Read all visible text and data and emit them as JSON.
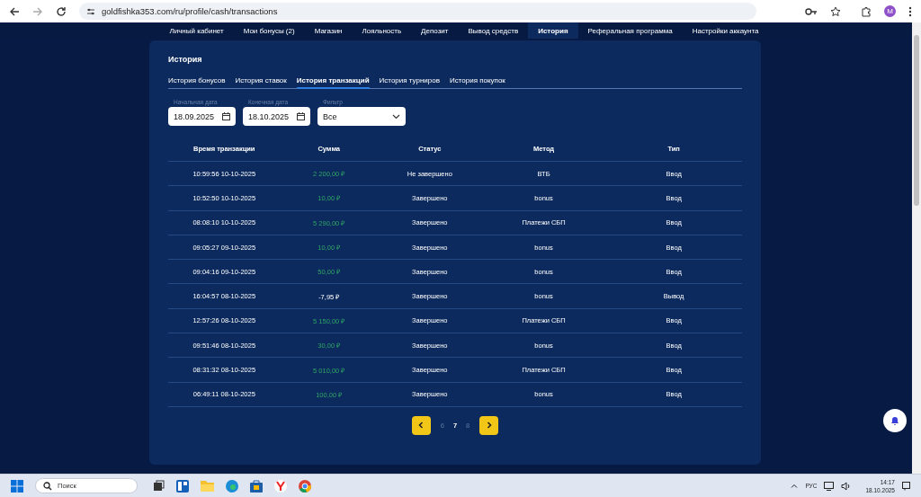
{
  "browser": {
    "url": "goldfishka353.com/ru/profile/cash/transactions",
    "profile_initial": "M"
  },
  "nav": [
    {
      "label": "Личный кабинет",
      "selected": false
    },
    {
      "label": "Мои бонусы  (2)",
      "selected": false
    },
    {
      "label": "Магазин",
      "selected": false
    },
    {
      "label": "Лояльность",
      "selected": false
    },
    {
      "label": "Депозит",
      "selected": false
    },
    {
      "label": "Вывод средств",
      "selected": false
    },
    {
      "label": "История",
      "selected": true
    },
    {
      "label": "Реферальная программа",
      "selected": false
    },
    {
      "label": "Настройки аккаунта",
      "selected": false
    }
  ],
  "panel": {
    "title": "История",
    "tabs": [
      {
        "label": "История бонусов",
        "selected": false
      },
      {
        "label": "История ставок",
        "selected": false
      },
      {
        "label": "История транзакций",
        "selected": true
      },
      {
        "label": "История турниров",
        "selected": false
      },
      {
        "label": "История покупок",
        "selected": false
      }
    ],
    "filters": [
      {
        "kind": "date",
        "label": "Начальная дата",
        "value": "18.09.2025"
      },
      {
        "kind": "date",
        "label": "Конечная дата",
        "value": "18.10.2025"
      },
      {
        "kind": "select",
        "label": "Фильтр",
        "value": "Все"
      }
    ],
    "table": {
      "columns": [
        "Время транзакции",
        "Сумма",
        "Статус",
        "Метод",
        "Тип"
      ],
      "rows": [
        {
          "time": "10:59:56 10-10-2025",
          "amount": "2 200,00 ₽",
          "incoming": true,
          "status": "Не завершено",
          "method": "ВТБ",
          "type": "Ввод"
        },
        {
          "time": "10:52:50 10-10-2025",
          "amount": "10,00 ₽",
          "incoming": true,
          "status": "Завершено",
          "method": "bonus",
          "type": "Ввод"
        },
        {
          "time": "08:08:10 10-10-2025",
          "amount": "5 290,00 ₽",
          "incoming": true,
          "status": "Завершено",
          "method": "Платежи СБП",
          "type": "Ввод"
        },
        {
          "time": "09:05:27 09-10-2025",
          "amount": "10,00 ₽",
          "incoming": true,
          "status": "Завершено",
          "method": "bonus",
          "type": "Ввод"
        },
        {
          "time": "09:04:16 09-10-2025",
          "amount": "50,00 ₽",
          "incoming": true,
          "status": "Завершено",
          "method": "bonus",
          "type": "Ввод"
        },
        {
          "time": "16:04:57 08-10-2025",
          "amount": "-7,95 ₽",
          "incoming": false,
          "status": "Завершено",
          "method": "bonus",
          "type": "Вывод"
        },
        {
          "time": "12:57:26 08-10-2025",
          "amount": "5 150,00 ₽",
          "incoming": true,
          "status": "Завершено",
          "method": "Платежи СБП",
          "type": "Ввод"
        },
        {
          "time": "09:51:46 08-10-2025",
          "amount": "30,00 ₽",
          "incoming": true,
          "status": "Завершено",
          "method": "bonus",
          "type": "Ввод"
        },
        {
          "time": "08:31:32 08-10-2025",
          "amount": "5 010,00 ₽",
          "incoming": true,
          "status": "Завершено",
          "method": "Платежи СБП",
          "type": "Ввод"
        },
        {
          "time": "06:49:11 08-10-2025",
          "amount": "100,00 ₽",
          "incoming": true,
          "status": "Завершено",
          "method": "bonus",
          "type": "Ввод"
        }
      ]
    },
    "pagination": [
      {
        "label": "6",
        "selected": false
      },
      {
        "label": "7",
        "selected": true
      },
      {
        "label": "8",
        "selected": false
      }
    ]
  },
  "taskbar": {
    "search_placeholder": "Поиск",
    "language": "РУС",
    "time": "14:17",
    "date": "18.10.2025"
  }
}
